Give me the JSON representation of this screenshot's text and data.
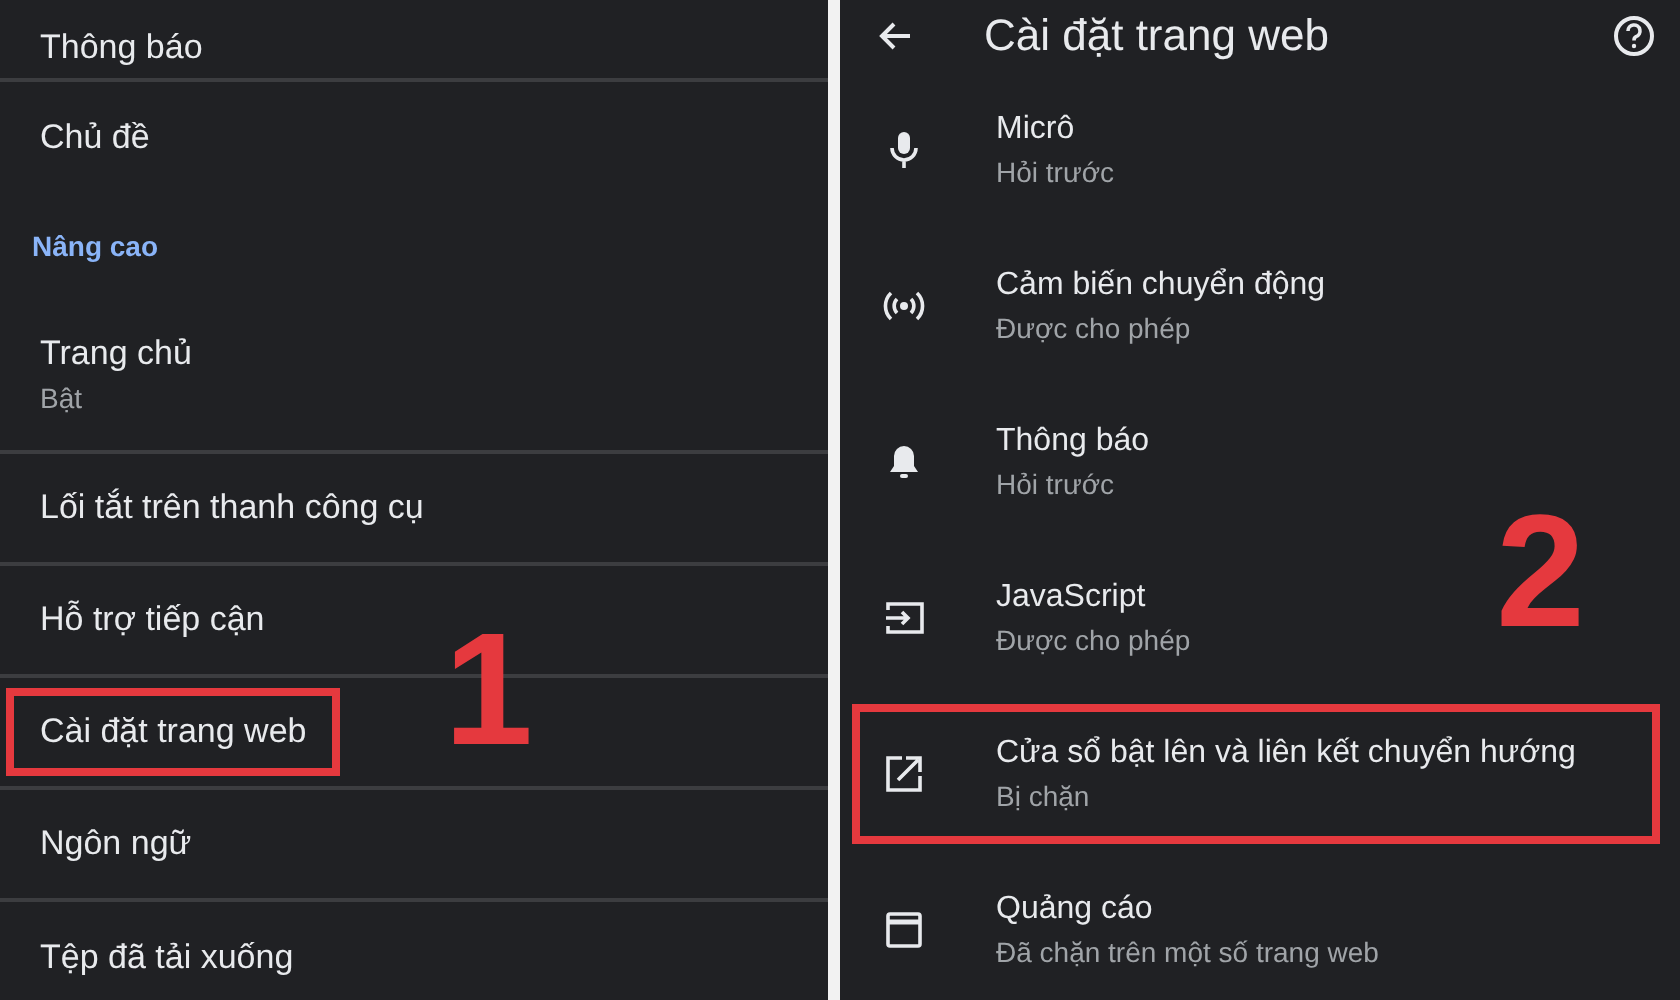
{
  "left_panel": {
    "step_label": "1",
    "items": [
      {
        "kind": "item",
        "title": "Thông báo",
        "divider": true,
        "highlighted": false
      },
      {
        "kind": "item",
        "title": "Chủ đề",
        "divider": false,
        "highlighted": false
      },
      {
        "kind": "header",
        "title": "Nâng cao"
      },
      {
        "kind": "item",
        "title": "Trang chủ",
        "subtitle": "Bật",
        "divider": true,
        "highlighted": false
      },
      {
        "kind": "item",
        "title": "Lối tắt trên thanh công cụ",
        "divider": true,
        "highlighted": false
      },
      {
        "kind": "item",
        "title": "Hỗ trợ tiếp cận",
        "divider": true,
        "highlighted": false
      },
      {
        "kind": "item",
        "title": "Cài đặt trang web",
        "divider": true,
        "highlighted": true
      },
      {
        "kind": "item",
        "title": "Ngôn ngữ",
        "divider": true,
        "highlighted": false
      },
      {
        "kind": "item",
        "title": "Tệp đã tải xuống",
        "divider": false,
        "highlighted": false
      }
    ]
  },
  "right_panel": {
    "title": "Cài đặt trang web",
    "step_label": "2",
    "items": [
      {
        "kind": "mic",
        "title": "Micrô",
        "subtitle": "Hỏi trước",
        "highlighted": false
      },
      {
        "kind": "sensors",
        "title": "Cảm biến chuyển động",
        "subtitle": "Được cho phép",
        "highlighted": false
      },
      {
        "kind": "bell",
        "title": "Thông báo",
        "subtitle": "Hỏi trước",
        "highlighted": false
      },
      {
        "kind": "javascript",
        "title": "JavaScript",
        "subtitle": "Được cho phép",
        "highlighted": false
      },
      {
        "kind": "popup",
        "title": "Cửa sổ bật lên và liên kết chuyển hướng",
        "subtitle": "Bị chặn",
        "highlighted": true
      },
      {
        "kind": "ads",
        "title": "Quảng cáo",
        "subtitle": "Đã chặn trên một số trang web",
        "highlighted": false
      }
    ]
  }
}
